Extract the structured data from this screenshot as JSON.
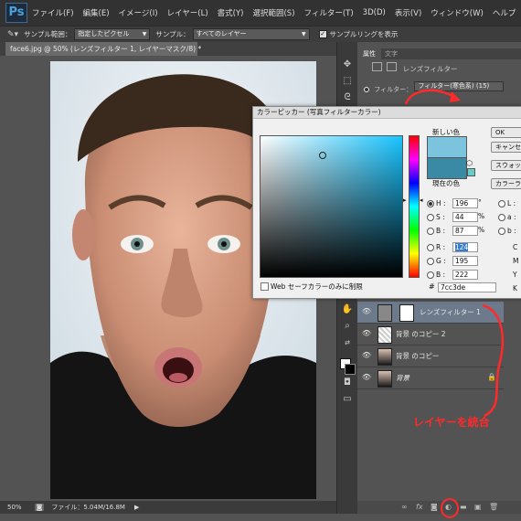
{
  "menubar": {
    "logo": "Ps",
    "items": [
      "ファイル(F)",
      "編集(E)",
      "イメージ(I)",
      "レイヤー(L)",
      "書式(Y)",
      "選択範囲(S)",
      "フィルター(T)",
      "3D(D)",
      "表示(V)",
      "ウィンドウ(W)",
      "ヘルプ"
    ]
  },
  "options": {
    "sample_size_label": "サンプル範囲：",
    "sample_size_value": "指定したピクセル",
    "sample_label": "サンプル：",
    "sample_value": "すべてのレイヤー",
    "ring_label": "サンプルリングを表示"
  },
  "document": {
    "tab_title": "face6.jpg @ 50% (レンズフィルター 1, レイヤーマスク/8) *",
    "zoom": "50%",
    "file_info": "ファイル：5.04M/16.8M"
  },
  "panel": {
    "tabs": [
      "属性",
      "文字"
    ],
    "props_title": "レンズフィルター",
    "filter_label": "フィルター：",
    "filter_value": "フィルター(寒色系) (15)"
  },
  "layers": [
    {
      "name": "レンズフィルター 1",
      "kind": "adjustment",
      "selected": true
    },
    {
      "name": "背景 のコピー 2",
      "kind": "transparent",
      "selected": false
    },
    {
      "name": "背景 のコピー",
      "kind": "photo",
      "selected": false
    },
    {
      "name": "背景",
      "kind": "photo",
      "selected": false,
      "locked": true
    }
  ],
  "color_picker": {
    "title": "カラーピッカー (写真フィルターカラー)",
    "new_label": "新しい色",
    "current_label": "現在の色",
    "new_color": "#7cc3de",
    "current_color": "#3a8aa6",
    "buttons": [
      "OK",
      "キャンセル",
      "スウォッチに追加",
      "カラーライブラリ"
    ],
    "web_only_label": "Web セーフカラーのみに制限",
    "hsb": [
      {
        "label": "H",
        "value": "196",
        "unit": "°"
      },
      {
        "label": "S",
        "value": "44",
        "unit": "%"
      },
      {
        "label": "B",
        "value": "87",
        "unit": "%"
      }
    ],
    "rgb": [
      {
        "label": "R",
        "value": "124"
      },
      {
        "label": "G",
        "value": "195"
      },
      {
        "label": "B",
        "value": "222"
      }
    ],
    "lab_labels": [
      "L",
      "a",
      "b"
    ],
    "cmyk_labels": [
      "C",
      "M",
      "Y",
      "K"
    ],
    "hex_label": "#",
    "hex_value": "7cc3de"
  },
  "annotation": {
    "text": "レイヤーを統合",
    "color": "#ff2a2a"
  }
}
